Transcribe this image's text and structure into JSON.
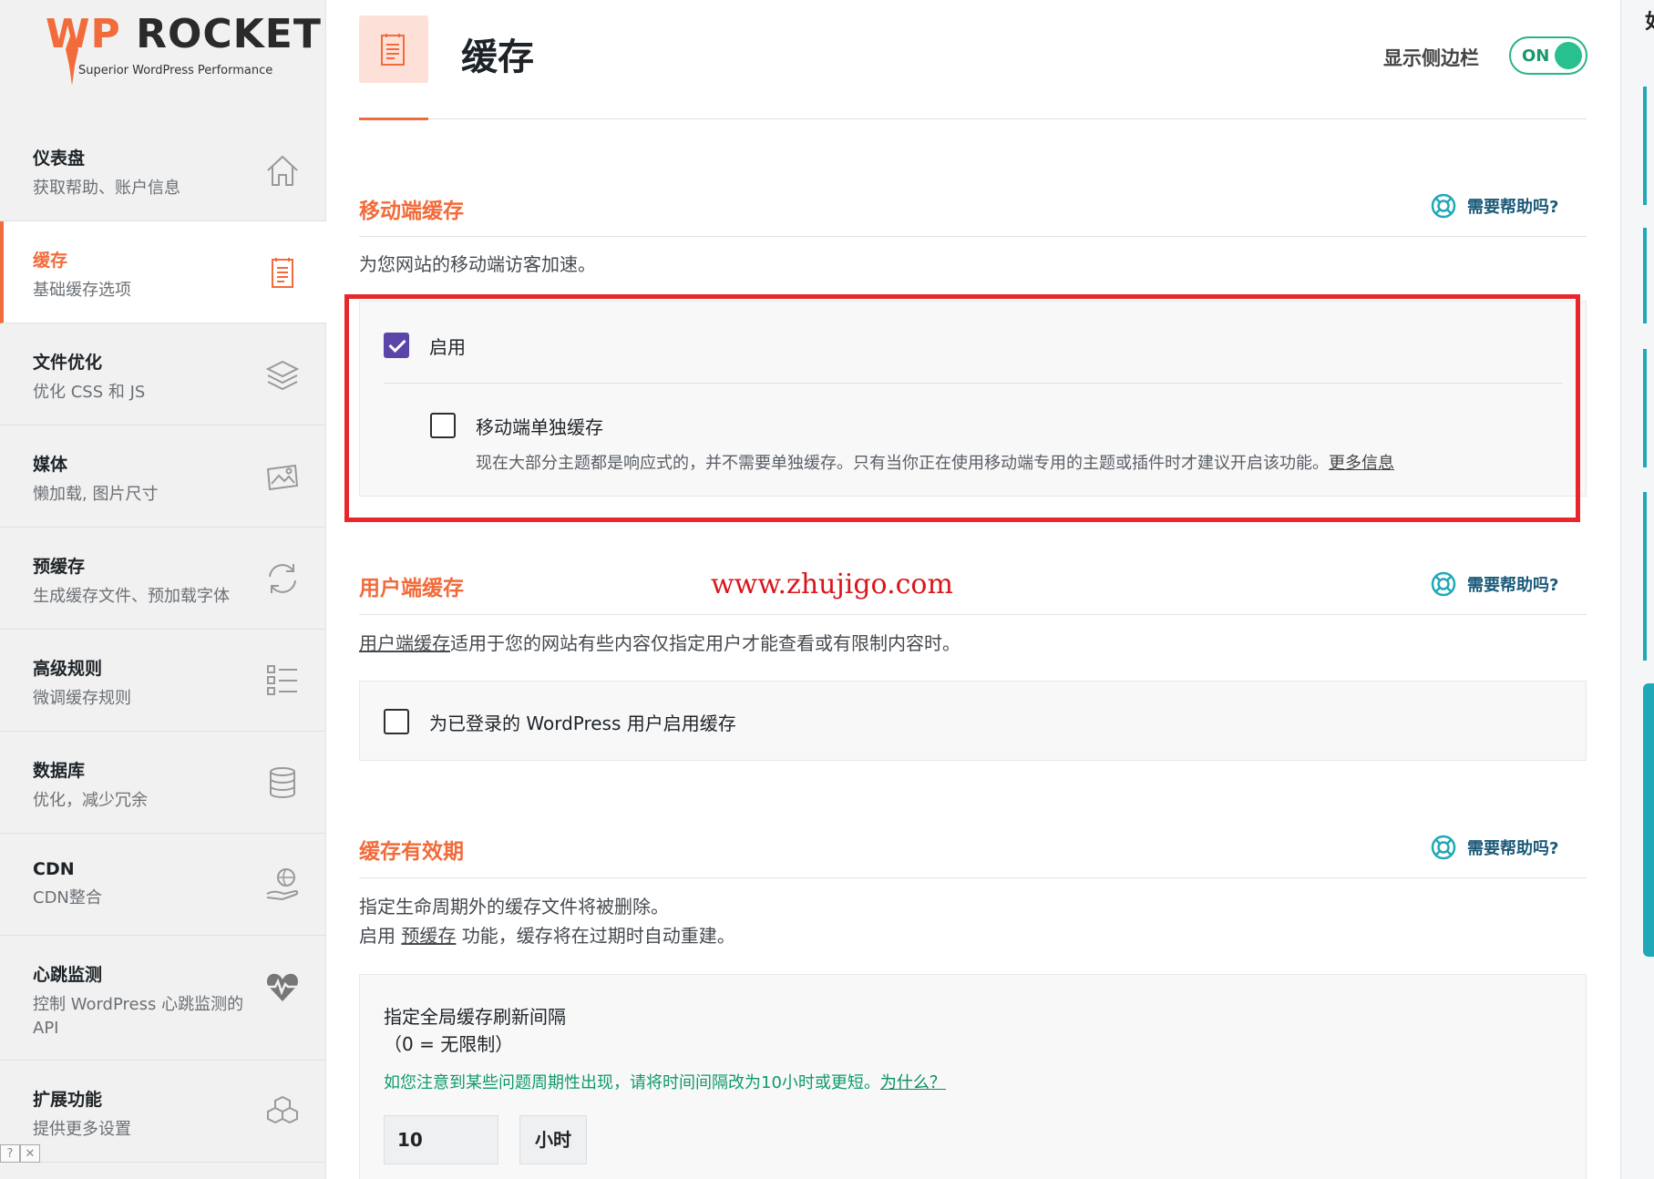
{
  "brand": {
    "name_wp": "WP",
    "name_rest": "ROCKET",
    "tagline": "Superior WordPress Performance",
    "accent": "#f26b3a"
  },
  "sidebar": {
    "items": [
      {
        "title": "仪表盘",
        "sub": "获取帮助、账户信息",
        "icon": "home-icon"
      },
      {
        "title": "缓存",
        "sub": "基础缓存选项",
        "icon": "document-icon"
      },
      {
        "title": "文件优化",
        "sub": "优化 CSS 和 JS",
        "icon": "layers-icon"
      },
      {
        "title": "媒体",
        "sub": "懒加载, 图片尺寸",
        "icon": "image-icon"
      },
      {
        "title": "预缓存",
        "sub": "生成缓存文件、预加载字体",
        "icon": "refresh-icon"
      },
      {
        "title": "高级规则",
        "sub": "微调缓存规则",
        "icon": "list-icon"
      },
      {
        "title": "数据库",
        "sub": "优化，减少冗余",
        "icon": "database-icon"
      },
      {
        "title": "CDN",
        "sub": "CDN整合",
        "icon": "cdn-hand-icon"
      },
      {
        "title": "心跳监测",
        "sub": "控制 WordPress 心跳监测的 API",
        "icon": "heartbeat-icon"
      },
      {
        "title": "扩展功能",
        "sub": "提供更多设置",
        "icon": "cubes-icon"
      }
    ],
    "active_index": 1
  },
  "corner": {
    "help": "?",
    "close": "✕"
  },
  "header": {
    "title": "缓存",
    "sidebar_toggle_label": "显示侧边栏",
    "toggle_state": "ON"
  },
  "help_label": "需要帮助吗?",
  "mobile_cache": {
    "title": "移动端缓存",
    "description": "为您网站的移动端访客加速。",
    "enable_label": "启用",
    "enable_checked": true,
    "separate_label": "移动端单独缓存",
    "separate_checked": false,
    "separate_desc": "现在大部分主题都是响应式的，并不需要单独缓存。只有当你正在使用移动端专用的主题或插件时才建议开启该功能。",
    "more_info": "更多信息"
  },
  "watermark": "www.zhujigo.com",
  "user_cache": {
    "title": "用户端缓存",
    "desc_link": "用户端缓存",
    "desc_rest": "适用于您的网站有些内容仅指定用户才能查看或有限制内容时。",
    "option_label": "为已登录的 WordPress 用户启用缓存",
    "option_checked": false
  },
  "cache_lifespan": {
    "title": "缓存有效期",
    "desc_line1": "指定生命周期外的缓存文件将被删除。",
    "desc_line2_pre": "启用 ",
    "desc_line2_link": "预缓存",
    "desc_line2_post": " 功能，缓存将在过期时自动重建。",
    "field_label": "指定全局缓存刷新间隔",
    "field_hint": "（0 = 无限制）",
    "note": "如您注意到某些问题周期性出现，请将时间间隔改为10小时或更短。",
    "note_link": "为什么？",
    "value": "10",
    "unit": "小时"
  },
  "right_edge": {
    "char": "如"
  }
}
